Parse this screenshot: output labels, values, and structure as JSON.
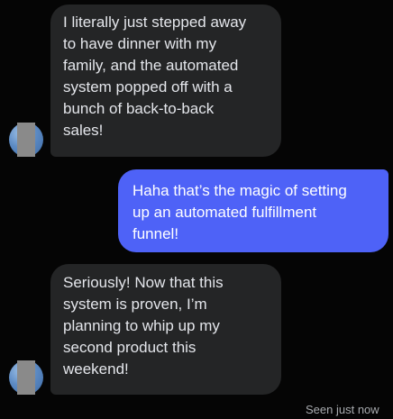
{
  "messages": [
    {
      "direction": "incoming",
      "text": "I literally just stepped away\nto have dinner with my\nfamily, and the automated\nsystem popped off with a\nbunch of back-to-back\nsales!"
    },
    {
      "direction": "outgoing",
      "text": "Haha that’s the magic of setting\nup an automated fulfillment\nfunnel!"
    },
    {
      "direction": "incoming",
      "text": "Seriously! Now that this\nsystem is proven, I’m\nplanning to whip up my\nsecond product this\nweekend!"
    }
  ],
  "status": {
    "seen_text": "Seen just now"
  },
  "colors": {
    "background": "#050505",
    "incoming_bubble": "#242526",
    "outgoing_bubble": "#4e62f7",
    "incoming_text": "#e4e6eb",
    "outgoing_text": "#ffffff",
    "status_text": "#a8abaf"
  }
}
